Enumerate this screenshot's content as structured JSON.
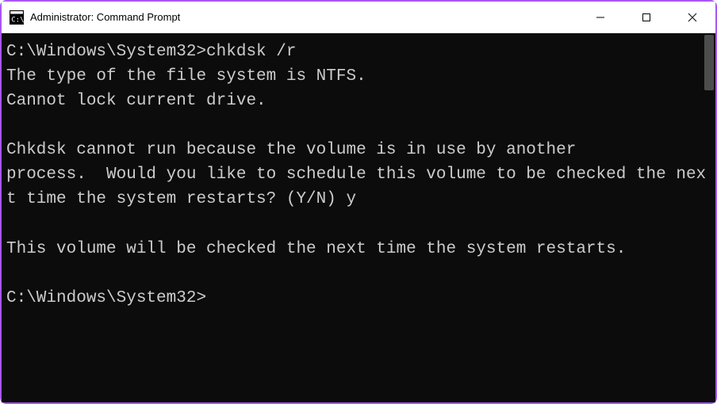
{
  "titlebar": {
    "title": "Administrator: Command Prompt"
  },
  "terminal": {
    "prompt1": "C:\\Windows\\System32>",
    "command1": "chkdsk /r",
    "line1": "The type of the file system is NTFS.",
    "line2": "Cannot lock current drive.",
    "blank1": " ",
    "line3": "Chkdsk cannot run because the volume is in use by another",
    "line4": "process.  Would you like to schedule this volume to be checked the next time the system restarts? (Y/N) y",
    "blank2": " ",
    "line5": "This volume will be checked the next time the system restarts.",
    "blank3": " ",
    "prompt2": "C:\\Windows\\System32>"
  }
}
